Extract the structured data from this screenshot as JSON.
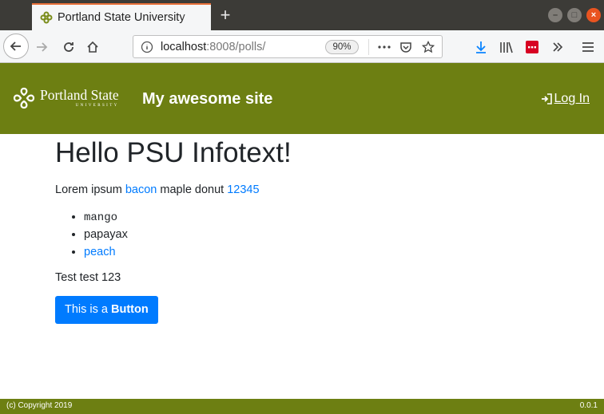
{
  "browser": {
    "tab_title": "Portland State University",
    "new_tab": "+",
    "url_host": "localhost",
    "url_rest": ":8008/polls/",
    "zoom": "90%",
    "colors": {
      "chrome": "#3c3b37",
      "toolbar": "#f5f6f7",
      "close": "#e95420"
    }
  },
  "header": {
    "logo_text": "Portland State",
    "logo_subtext": "UNIVERSITY",
    "site_title": "My awesome site",
    "login_label": "Log In",
    "bg_color": "#6d7f12"
  },
  "main": {
    "heading": "Hello PSU Infotext!",
    "lorem_1": "Lorem ipsum ",
    "link_bacon": "bacon",
    "lorem_2": " maple donut ",
    "link_number": "12345",
    "list": {
      "item_mango": "mango",
      "item_papayax": "papayax",
      "item_peach": "peach"
    },
    "test_text": "Test test 123",
    "button_prefix": "This is a ",
    "button_bold": "Button",
    "link_color": "#007bff"
  },
  "footer": {
    "copyright": "(c) Copyright 2019",
    "version": "0.0.1"
  }
}
